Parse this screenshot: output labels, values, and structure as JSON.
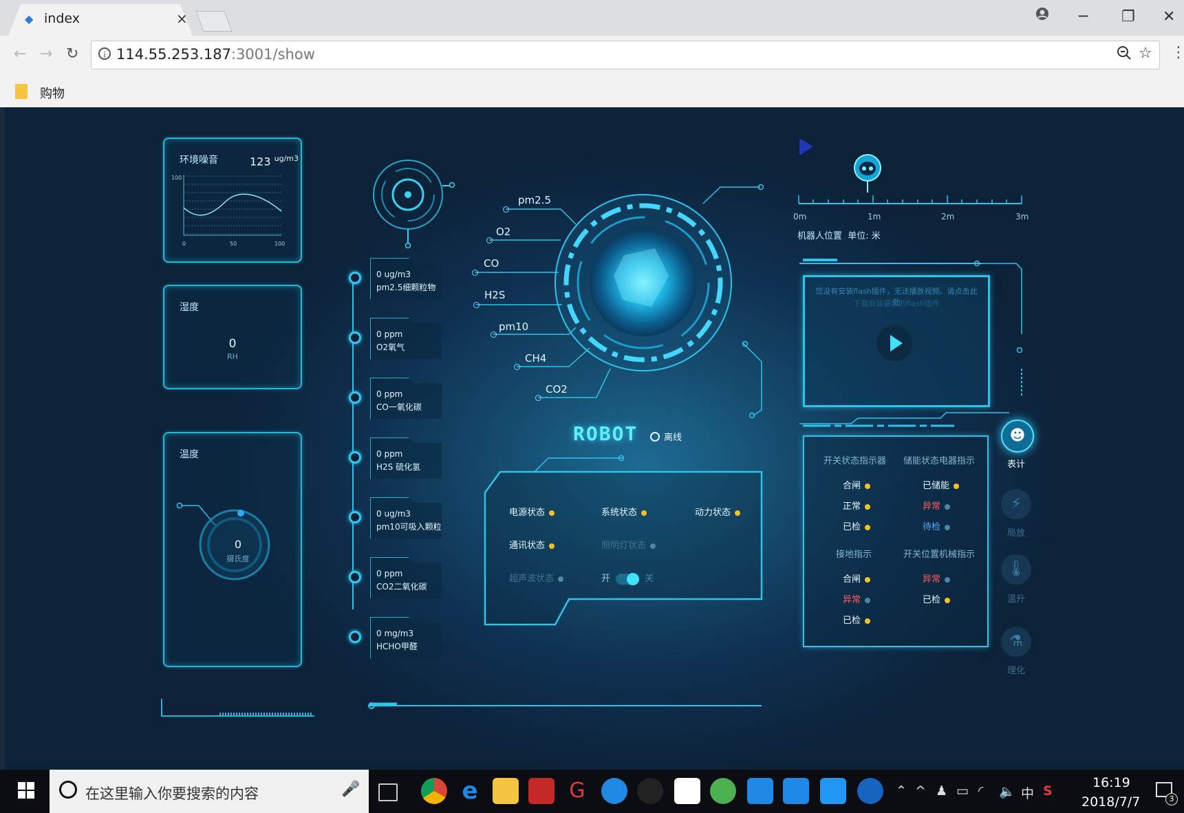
{
  "browser": {
    "tab_title": "index",
    "tab_close": "×",
    "url_host": "114.55.253.187",
    "url_rest": ":3001/show",
    "bookmark_label": "购物",
    "minimize": "─",
    "restore": "❐",
    "close": "✕"
  },
  "noise_panel": {
    "title": "环境噪音",
    "value": "123",
    "unit": "ug/m3",
    "y_tick": "100",
    "x_ticks": [
      "0",
      "50",
      "100"
    ]
  },
  "humidity_panel": {
    "title": "湿度",
    "value": "0",
    "unit": "RH"
  },
  "temperature_panel": {
    "title": "温度",
    "value": "0",
    "unit": "摄氏度"
  },
  "sensors": [
    {
      "value": "0 ug/m3",
      "name": "pm2.5细颗粒物"
    },
    {
      "value": "0 ppm",
      "name": "O2氧气"
    },
    {
      "value": "0 ppm",
      "name": "CO一氧化碳"
    },
    {
      "value": "0 ppm",
      "name": "H2S 硫化氢"
    },
    {
      "value": "0 ug/m3",
      "name": "pm10可吸入颗粒"
    },
    {
      "value": "0 ppm",
      "name": "CO2二氧化碳"
    },
    {
      "value": "0 mg/m3",
      "name": "HCHO甲醛"
    }
  ],
  "gas_labels": [
    "pm2.5",
    "O2",
    "CO",
    "H2S",
    "pm10",
    "CH4",
    "CO2"
  ],
  "robot": {
    "title": "ROBOT",
    "status": "离线"
  },
  "robot_status": {
    "power": "电源状态",
    "system": "系统状态",
    "motion": "动力状态",
    "comm": "通讯状态",
    "light": "照明灯状态",
    "ultrasonic": "超声波状态",
    "switch_on": "开",
    "switch_off": "关"
  },
  "position": {
    "ticks": [
      "0m",
      "1m",
      "2m",
      "3m"
    ],
    "label": "机器人位置",
    "unit_label": "单位: 米"
  },
  "video": {
    "message": "您没有安装flash插件，无法播放视频。请点击此处",
    "message2": "下载安装最新的flash插件"
  },
  "indicator_panel": {
    "switch_title": "开关状态指示器",
    "storage_title": "储能状态电器指示",
    "switch_items": [
      "合闸",
      "正常",
      "已检"
    ],
    "storage_items": [
      "已储能",
      "异常",
      "待检"
    ],
    "ground_title": "接地指示",
    "mech_title": "开关位置机械指示",
    "ground_items": [
      "合闸",
      "异常",
      "已检"
    ],
    "mech_items": [
      "异常",
      "已检"
    ]
  },
  "side_menu": {
    "meter": "表计",
    "discharge": "局放",
    "temp_rise": "温升",
    "chem": "理化"
  },
  "taskbar": {
    "search_placeholder": "在这里输入你要搜索的内容",
    "time": "16:19",
    "date": "2018/7/7",
    "ime": "中",
    "notif_count": "3"
  },
  "colors": {
    "accent": "#28b6d6",
    "status_on": "#f4c321",
    "status_off": "#4a87a8",
    "alert": "#ff5b5b"
  }
}
